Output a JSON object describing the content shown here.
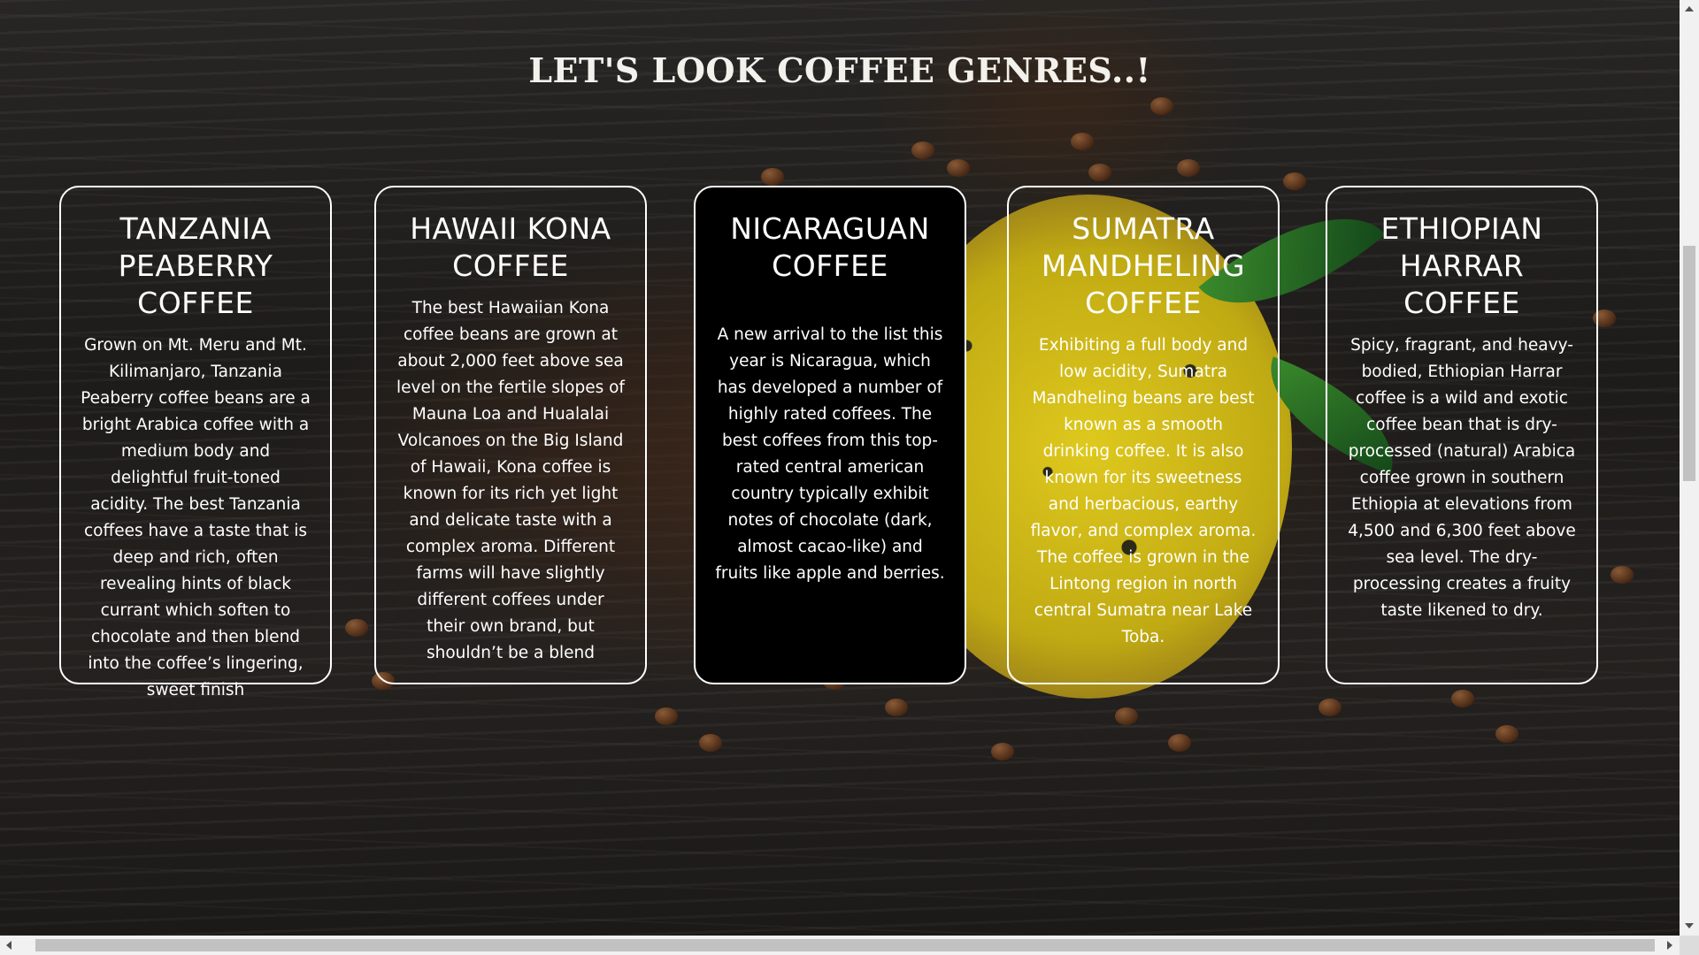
{
  "page": {
    "title": "LET'S LOOK COFFEE GENRES..!"
  },
  "cards": [
    {
      "title": "TANZANIA PEABERRY COFFEE",
      "text": "Grown on Mt. Meru and Mt. Kilimanjaro, Tanzania Peaberry coffee beans are a bright Arabica coffee with a medium body and delightful fruit-toned acidity. The best Tanzania coffees have a taste that is deep and rich, often revealing hints of black currant which soften to chocolate and then blend into the coffee’s lingering, sweet finish"
    },
    {
      "title": "HAWAII KONA COFFEE",
      "text": "The best Hawaiian Kona coffee beans are grown at about 2,000 feet above sea level on the fertile slopes of Mauna Loa and Hualalai Volcanoes on the Big Island of Hawaii, Kona coffee is known for its rich yet light and delicate taste with a complex aroma. Different farms will have slightly different coffees under their own brand, but shouldn’t be a blend"
    },
    {
      "title": "NICARAGUAN COFFEE",
      "text": "A new arrival to the list this year is Nicaragua, which has developed a number of highly rated coffees. The best coffees from this top-rated central american country typically exhibit notes of chocolate (dark, almost cacao-like) and fruits like apple and berries."
    },
    {
      "title": "SUMATRA MANDHELING COFFEE",
      "text": "Exhibiting a full body and low acidity, Sumatra Mandheling beans are best known as a smooth drinking coffee. It is also known for its sweetness and herbacious, earthy flavor, and complex aroma. The coffee is grown in the Lintong region in north central Sumatra near Lake Toba."
    },
    {
      "title": "ETHIOPIAN HARRAR COFFEE",
      "text": "Spicy, fragrant, and heavy-bodied, Ethiopian Harrar coffee is a wild and exotic coffee bean that is dry-processed (natural) Arabica coffee grown in southern Ethiopia at elevations from 4,500 and 6,300 feet above sea level. The dry-processing creates a fruity taste likened to dry."
    }
  ],
  "colors": {
    "card_border": "#ffffff",
    "highlight_card_bg": "#000000",
    "text": "#ffffff"
  }
}
